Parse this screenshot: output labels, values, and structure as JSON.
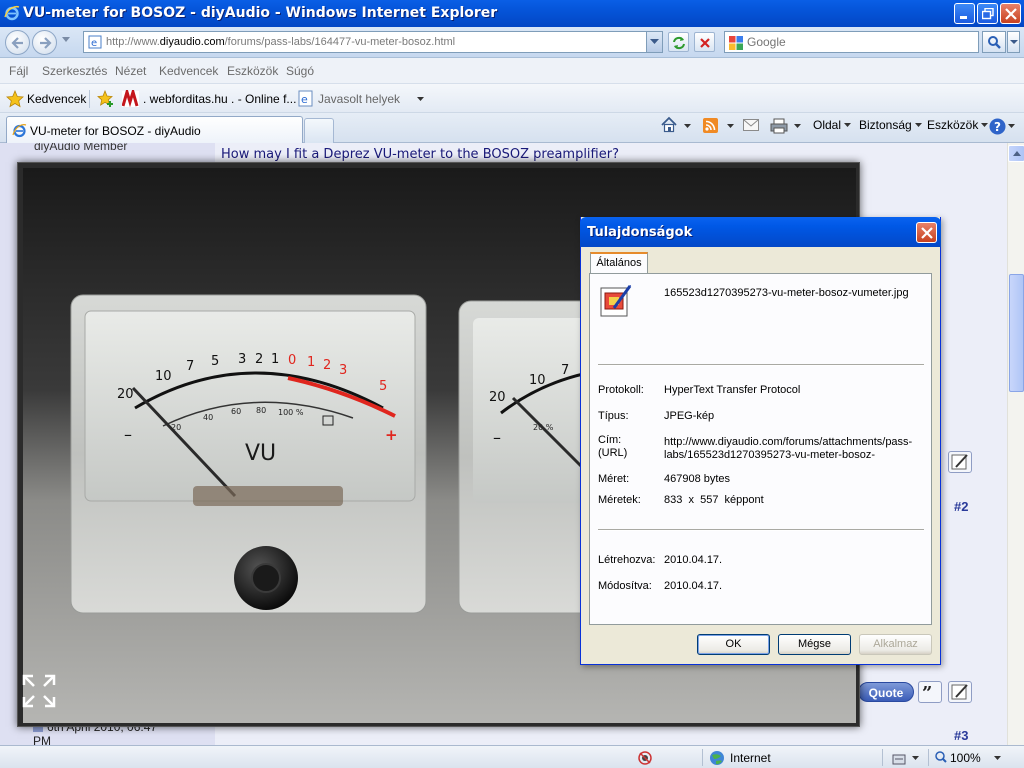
{
  "window": {
    "title": "VU-meter for BOSOZ - diyAudio - Windows Internet Explorer"
  },
  "address_bar": {
    "url_prefix": "http://www.",
    "url_domain": "diyaudio.com",
    "url_path": "/forums/pass-labs/164477-vu-meter-bosoz.html",
    "search_placeholder": "Google"
  },
  "menu": {
    "items": [
      "Fájl",
      "Szerkesztés",
      "Nézet",
      "Kedvencek",
      "Eszközök",
      "Súgó"
    ]
  },
  "favorites_bar": {
    "favorites_label": "Kedvencek",
    "item1": ". webforditas.hu . - Online f...",
    "item2": "Javasolt helyek"
  },
  "tabs": {
    "active_tab": "VU-meter for BOSOZ - diyAudio"
  },
  "command_bar": {
    "page": "Oldal",
    "safety": "Biztonság",
    "tools": "Eszközök"
  },
  "page": {
    "member_label": "diyAudio Member",
    "post_question": "How may I fit a Deprez VU-meter to the BOSOZ preamplifier?",
    "post2": "#2",
    "post3": "#3",
    "post_date_line1": "6th April 2010, 06:47",
    "post_date_line2": "PM",
    "quote_label": "Quote"
  },
  "photo": {
    "meter_scale_black": [
      "20",
      "10",
      "7",
      "5",
      "3",
      "2",
      "1"
    ],
    "meter_scale_red": [
      "0",
      "1",
      "2",
      "3",
      "5"
    ],
    "meter_percent": [
      "20",
      "40",
      "60",
      "80",
      "100 %"
    ],
    "meter_label": "VU",
    "meter_minus": "–",
    "meter_plus": "+",
    "meter2_scale": [
      "20",
      "10",
      "7"
    ],
    "meter2_percent": "20 %",
    "meter2_minus": "–",
    "needle_color": "#2a2a2a",
    "red_scale_color": "#e0261e"
  },
  "dialog": {
    "title": "Tulajdonságok",
    "tab": "Általános",
    "file_name": "165523d1270395273-vu-meter-bosoz-vumeter.jpg",
    "protocol_label": "Protokoll:",
    "protocol_value": "HyperText Transfer Protocol",
    "type_label": "Típus:",
    "type_value": "JPEG-kép",
    "address_label1": "Cím:",
    "address_label2": "(URL)",
    "address_value1": "http://www.diyaudio.com/forums/attachments/pass-",
    "address_value2": "labs/165523d1270395273-vu-meter-bosoz-",
    "size_label": "Méret:",
    "size_value": "467908 bytes",
    "dimensions_label": "Méretek:",
    "dimensions_value": "833  x  557  képpont",
    "created_label": "Létrehozva:",
    "created_value": "2010.04.17.",
    "modified_label": "Módosítva:",
    "modified_value": "2010.04.17.",
    "ok": "OK",
    "cancel": "Mégse",
    "apply": "Alkalmaz"
  },
  "status_bar": {
    "zone": "Internet",
    "zoom": "100%"
  }
}
